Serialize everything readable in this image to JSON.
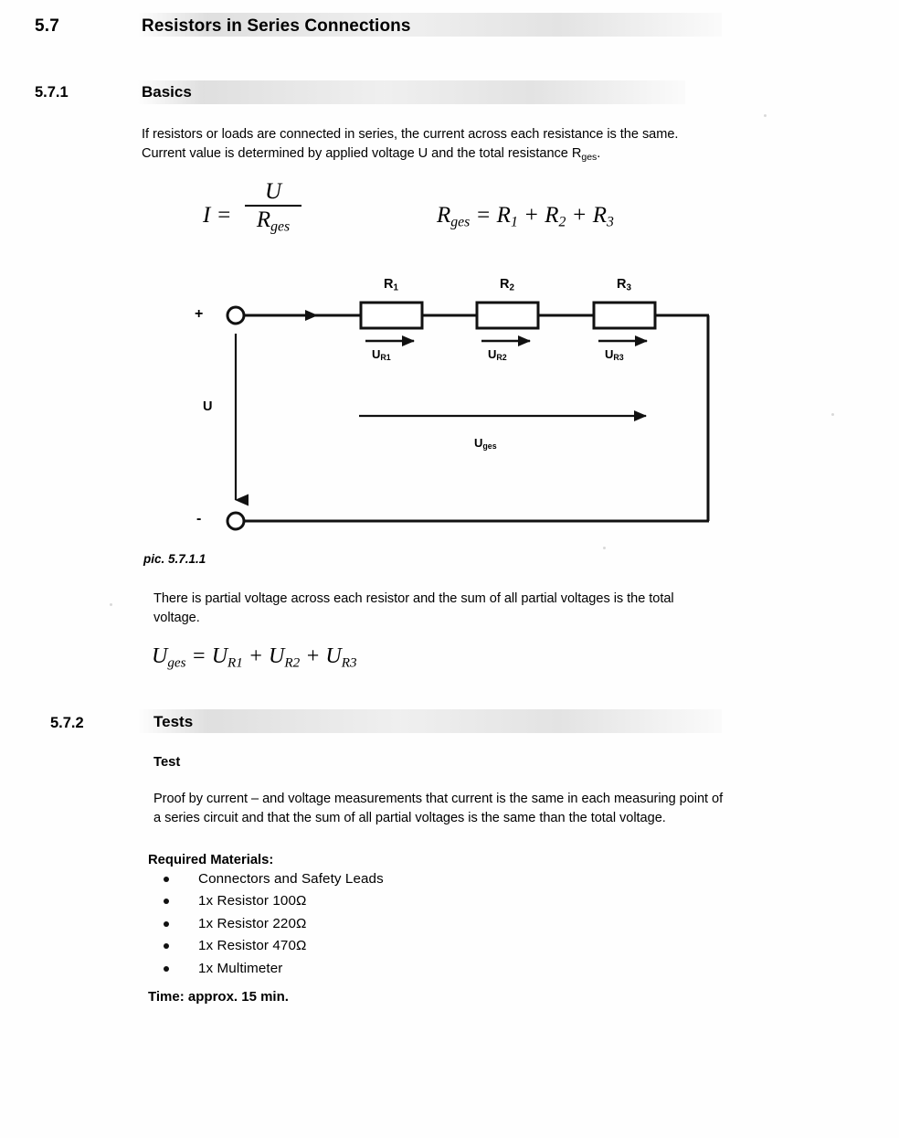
{
  "document": {
    "section": {
      "number": "5.7",
      "title": "Resistors in Series Connections"
    },
    "subsection_1": {
      "number": "5.7.1",
      "title": "Basics",
      "paragraph_line1": "If resistors or loads are connected in series, the current across each resistance is the same.",
      "paragraph_line2_a": "Current value is determined by applied voltage U and the total resistance R",
      "paragraph_line2_sub": "ges",
      "paragraph_line2_b": ".",
      "formula_current": {
        "lhs": "I =",
        "numerator": "U",
        "denominator_base": "R",
        "denominator_sub": "ges"
      },
      "formula_total_resistance": {
        "lhs_base": "R",
        "lhs_sub": "ges",
        "equals": "=",
        "term1_base": "R",
        "term1_sub": "1",
        "plus1": "+",
        "term2_base": "R",
        "term2_sub": "2",
        "plus2": "+",
        "term3_base": "R",
        "term3_sub": "3"
      },
      "figure": {
        "caption": "pic. 5.7.1.1",
        "plus_terminal": "+",
        "minus_terminal": "-",
        "source_voltage_label": "U",
        "total_voltage_label_base": "U",
        "total_voltage_label_sub": "ges",
        "resistors": [
          {
            "name_base": "R",
            "name_sub": "1",
            "voltage_base": "U",
            "voltage_sub": "R1"
          },
          {
            "name_base": "R",
            "name_sub": "2",
            "voltage_base": "U",
            "voltage_sub": "R2"
          },
          {
            "name_base": "R",
            "name_sub": "3",
            "voltage_base": "U",
            "voltage_sub": "R3"
          }
        ]
      },
      "paragraph2_line1": "There is partial voltage across each resistor and the sum of all partial voltages is the total",
      "paragraph2_line2": "voltage.",
      "formula_voltage_sum": {
        "lhs_base": "U",
        "lhs_sub": "ges",
        "equals": "=",
        "term1_base": "U",
        "term1_sub": "R1",
        "plus1": "+",
        "term2_base": "U",
        "term2_sub": "R2",
        "plus2": "+",
        "term3_base": "U",
        "term3_sub": "R3"
      }
    },
    "subsection_2": {
      "number": "5.7.2",
      "title": "Tests",
      "test_label": "Test",
      "description_line1": "Proof by current – and voltage measurements that current is the same in each measuring point of",
      "description_line2": "a series circuit and that the sum of all partial voltages is the same than the total voltage.",
      "materials_heading": "Required Materials:",
      "materials": [
        "Connectors and Safety Leads",
        "1x Resistor 100Ω",
        "1x Resistor 220Ω",
        "1x Resistor 470Ω",
        "1x Multimeter"
      ],
      "time_line": "Time: approx. 15 min."
    }
  },
  "colors": {
    "ink": "#000000",
    "paper": "#ffffff",
    "scan_shade": "#cdcdcd"
  }
}
